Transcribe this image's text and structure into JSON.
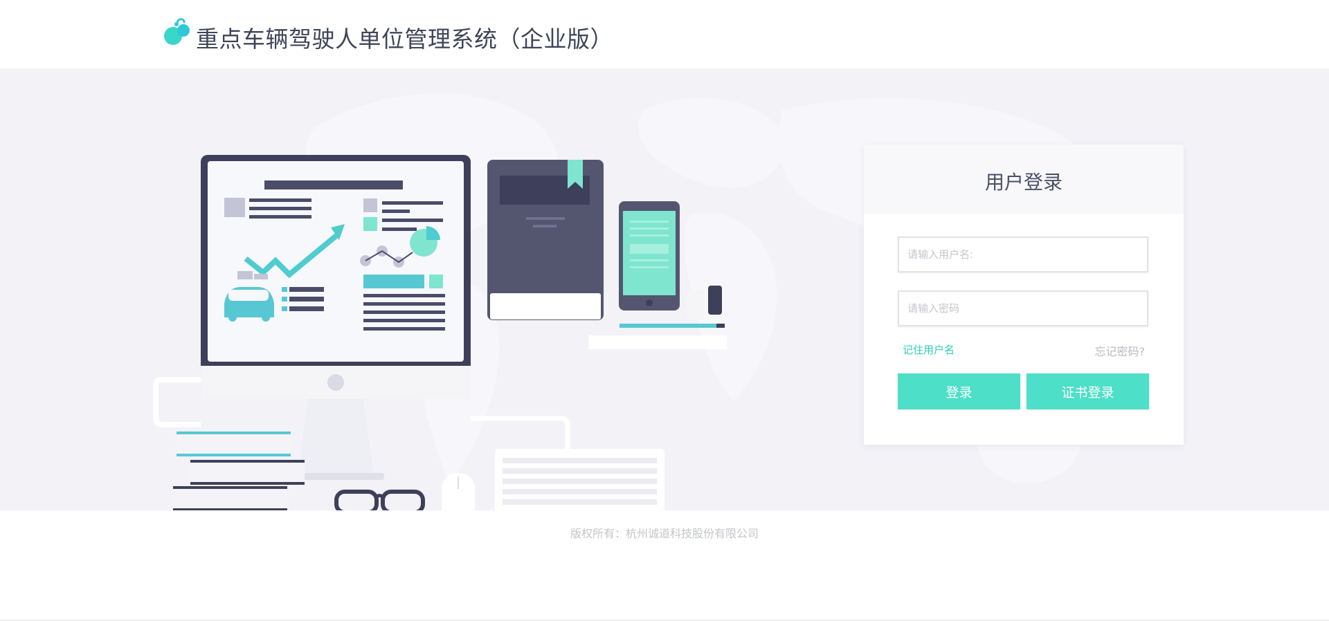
{
  "header": {
    "title": "重点车辆驾驶人单位管理系统（企业版）",
    "logo_icon": "cyan-blob-logo-icon"
  },
  "login": {
    "title": "用户登录",
    "username_placeholder": "请输入用户名:",
    "username_value": "",
    "password_placeholder": "请输入密码",
    "password_value": "",
    "remember_label": "记住用户名",
    "forgot_label": "忘记密码?",
    "login_button": "登录",
    "cert_login_button": "证书登录"
  },
  "footer": {
    "copyright": "版权所有：杭州诚道科技股份有限公司"
  },
  "colors": {
    "accent": "#4ddfc7",
    "link": "#2ccfb8",
    "hero_bg": "#f2f2f7",
    "title_text": "#3f4459"
  }
}
